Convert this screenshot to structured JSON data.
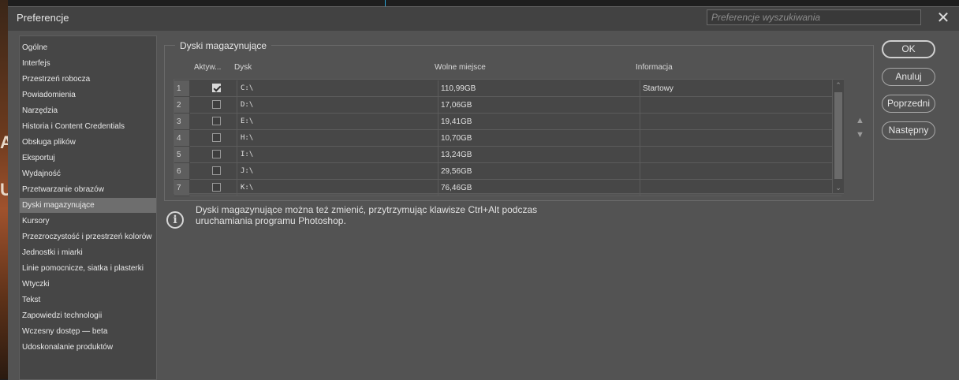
{
  "background": {
    "glyphs": [
      "A",
      "U"
    ]
  },
  "window": {
    "title": "Preferencje",
    "search_placeholder": "Preferencje wyszukiwania",
    "close_label": "✕"
  },
  "sidebar": {
    "selected_index": 12,
    "items": [
      "Ogólne",
      "Interfejs",
      "Przestrzeń robocza",
      "Powiadomienia",
      "Narzędzia",
      "Historia i Content Credentials",
      "Obsługa plików",
      "Eksportuj",
      "Wydajność",
      "Przetwarzanie obrazów",
      "Dyski magazynujące",
      "Kursory",
      "Przezroczystość i przestrzeń kolorów",
      "Jednostki i miarki",
      "Linie pomocnicze, siatka i plasterki",
      "Wtyczki",
      "Tekst",
      "Zapowiedzi technologii",
      "Wczesny dostęp — beta",
      "Udoskonalanie produktów"
    ]
  },
  "scratch_disks": {
    "group_title": "Dyski magazynujące",
    "columns": {
      "active": "Aktyw...",
      "disk": "Dysk",
      "free": "Wolne miejsce",
      "info": "Informacja"
    },
    "rows": [
      {
        "num": "1",
        "active": true,
        "disk": "C:\\",
        "free": "110,99GB",
        "info": "Startowy"
      },
      {
        "num": "2",
        "active": false,
        "disk": "D:\\",
        "free": "17,06GB",
        "info": ""
      },
      {
        "num": "3",
        "active": false,
        "disk": "E:\\",
        "free": "19,41GB",
        "info": ""
      },
      {
        "num": "4",
        "active": false,
        "disk": "H:\\",
        "free": "10,70GB",
        "info": ""
      },
      {
        "num": "5",
        "active": false,
        "disk": "I:\\",
        "free": "13,24GB",
        "info": ""
      },
      {
        "num": "6",
        "active": false,
        "disk": "J:\\",
        "free": "29,56GB",
        "info": ""
      },
      {
        "num": "7",
        "active": false,
        "disk": "K:\\",
        "free": "76,46GB",
        "info": ""
      }
    ],
    "move_up": "▲",
    "move_down": "▼"
  },
  "info_note": {
    "icon": "i",
    "line1": "Dyski magazynujące można też zmienić, przytrzymując klawisze Ctrl+Alt podczas",
    "line2": "uruchamiania programu Photoshop."
  },
  "buttons": {
    "ok": "OK",
    "cancel": "Anuluj",
    "previous": "Poprzedni",
    "next": "Następny"
  }
}
